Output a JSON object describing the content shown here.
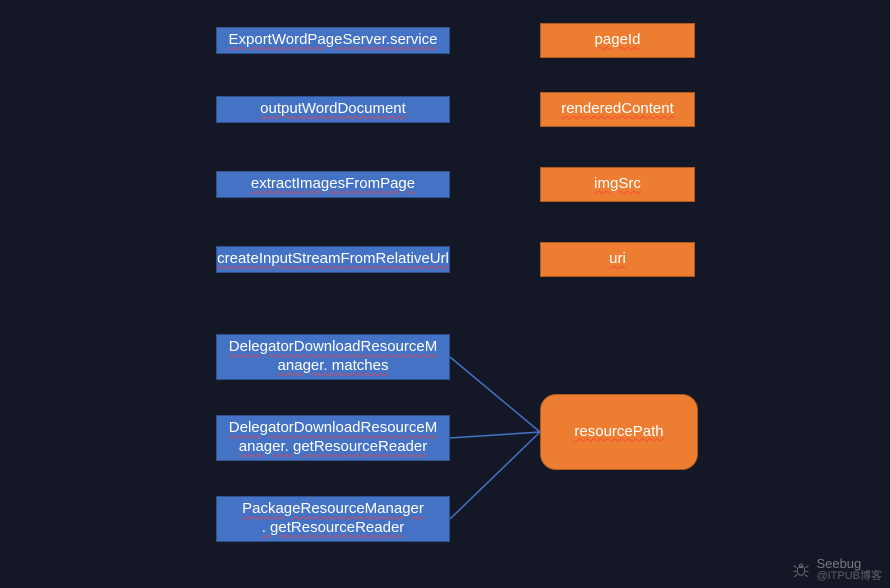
{
  "left": {
    "row1": "ExportWordPageServer.service",
    "row2": "outputWordDocument",
    "row3": "extractImagesFromPage",
    "row4": "createInputStreamFromRelativeUrl",
    "row5_line1": "DelegatorDownloadResourceM",
    "row5_line2": "anager. matches",
    "row6_line1": "DelegatorDownloadResourceM",
    "row6_line2": "anager. getResourceReader",
    "row7_line1": "PackageResourceManager",
    "row7_line2": ". getResourceReader"
  },
  "right": {
    "row1": "pageId",
    "row2": "renderedContent",
    "row3": "imgSrc",
    "row4": "uri",
    "big": "resourcePath"
  },
  "watermark": {
    "brand": "Seebug",
    "source": "@ITPUB博客"
  }
}
